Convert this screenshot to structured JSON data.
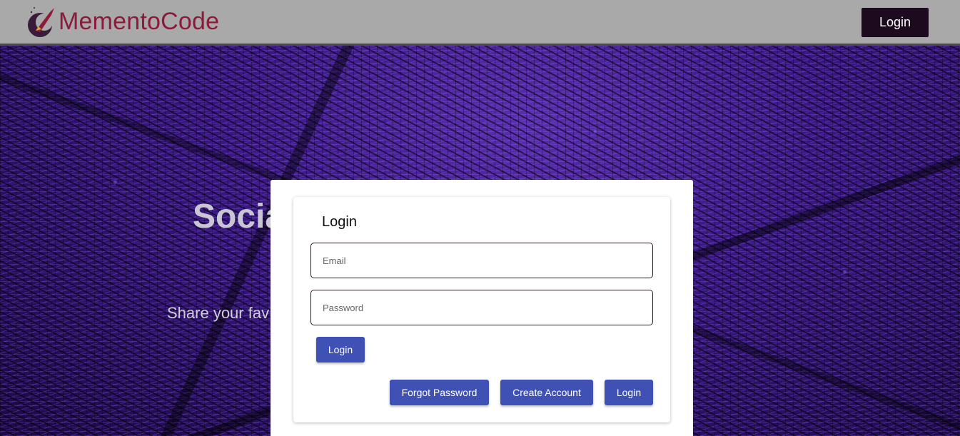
{
  "header": {
    "logo_text": "MementoCode",
    "login_label": "Login"
  },
  "hero": {
    "title": "Socia",
    "subtitle": "Share your fav"
  },
  "login_dialog": {
    "title": "Login",
    "email_placeholder": "Email",
    "password_placeholder": "Password",
    "login_button": "Login",
    "forgot_button": "Forgot Password",
    "create_button": "Create Account",
    "login_alt_button": "Login"
  },
  "colors": {
    "header_bg": "#a9a9a9",
    "brand": "#8b1a3b",
    "primary_button": "#3f51b5",
    "header_button": "#1d0a1f"
  },
  "icons": {
    "logo": "rocket-logo-icon"
  }
}
